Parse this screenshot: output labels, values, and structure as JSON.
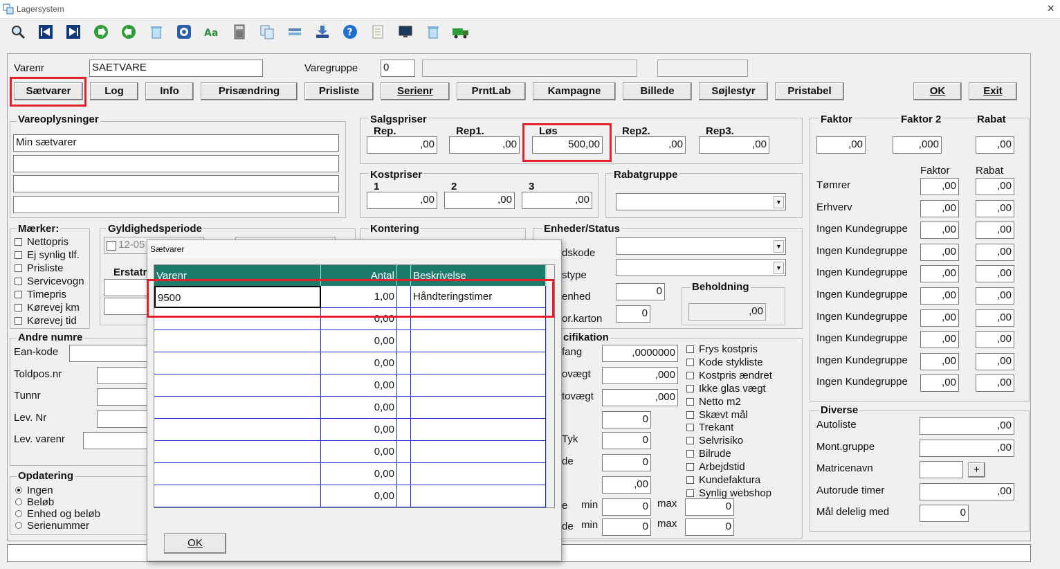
{
  "window": {
    "title": "Lagersystem",
    "close": "×"
  },
  "toolbar": {
    "icons": [
      "search-icon",
      "first-record-icon",
      "last-record-icon",
      "forward-icon",
      "back-icon",
      "delete-icon",
      "target-icon",
      "spell-icon",
      "calculator-icon",
      "copy-icon",
      "transfer-icon",
      "download-icon",
      "help-icon",
      "note-icon",
      "monitor-icon",
      "trash-icon",
      "truck-icon"
    ]
  },
  "header": {
    "varenr_label": "Varenr",
    "varenr_value": "SAETVARE",
    "varegruppe_label": "Varegruppe",
    "varegruppe_value": "0",
    "varegruppe_desc": "",
    "extra_field": ""
  },
  "buttons": {
    "saetvarer": "Sætvarer",
    "log": "Log",
    "info": "Info",
    "prisaendring": "Prisændring",
    "prisliste": "Prisliste",
    "serienr": "Serienr",
    "prntlab": "PrntLab",
    "kampagne": "Kampagne",
    "billede": "Billede",
    "sojlestyr": "Søjlestyr",
    "pristabel": "Pristabel",
    "ok": "OK",
    "exit": "Exit"
  },
  "vareoplysninger": {
    "title": "Vareoplysninger",
    "lines": [
      "Min sætvarer",
      "",
      "",
      ""
    ]
  },
  "salgspriser": {
    "title": "Salgspriser",
    "cols": [
      {
        "label": "Rep.",
        "value": ",00"
      },
      {
        "label": "Rep1.",
        "value": ",00"
      },
      {
        "label": "Løs",
        "value": "500,00"
      },
      {
        "label": "Rep2.",
        "value": ",00"
      },
      {
        "label": "Rep3.",
        "value": ",00"
      }
    ]
  },
  "kostpriser": {
    "title": "Kostpriser",
    "cols": [
      {
        "label": "1",
        "value": ",00"
      },
      {
        "label": "2",
        "value": ",00"
      },
      {
        "label": "3",
        "value": ",00"
      }
    ]
  },
  "rabatgruppe": {
    "title": "Rabatgruppe",
    "value": ""
  },
  "faktor_top": {
    "faktor_label": "Faktor",
    "faktor_value": ",00",
    "faktor2_label": "Faktor 2",
    "faktor2_value": ",000",
    "rabat_label": "Rabat",
    "rabat_value": ",00"
  },
  "kundegrupper": {
    "faktor_header": "Faktor",
    "rabat_header": "Rabat",
    "rows": [
      {
        "name": "Tømrer",
        "faktor": ",00",
        "rabat": ",00"
      },
      {
        "name": "Erhverv",
        "faktor": ",00",
        "rabat": ",00"
      },
      {
        "name": "Ingen Kundegruppe",
        "faktor": ",00",
        "rabat": ",00"
      },
      {
        "name": "Ingen Kundegruppe",
        "faktor": ",00",
        "rabat": ",00"
      },
      {
        "name": "Ingen Kundegruppe",
        "faktor": ",00",
        "rabat": ",00"
      },
      {
        "name": "Ingen Kundegruppe",
        "faktor": ",00",
        "rabat": ",00"
      },
      {
        "name": "Ingen Kundegruppe",
        "faktor": ",00",
        "rabat": ",00"
      },
      {
        "name": "Ingen Kundegruppe",
        "faktor": ",00",
        "rabat": ",00"
      },
      {
        "name": "Ingen Kundegruppe",
        "faktor": ",00",
        "rabat": ",00"
      },
      {
        "name": "Ingen Kundegruppe",
        "faktor": ",00",
        "rabat": ",00"
      }
    ]
  },
  "maerker": {
    "title": "Mærker:",
    "items": [
      "Nettopris",
      "Ej synlig tlf.",
      "Prisliste",
      "Servicevogn",
      "Timepris",
      "Kørevej km",
      "Kørevej tid"
    ]
  },
  "gyldighed": {
    "title": "Gyldighedsperiode",
    "date": "12-05",
    "erstat": "Erstatr"
  },
  "kontering": {
    "title": "Kontering"
  },
  "enheder": {
    "title": "Enheder/Status",
    "labels": [
      "dskode",
      "stype",
      "enhed",
      "or.karton"
    ],
    "enhed_value": "0",
    "karton_value": "0",
    "beholdning_label": "Beholdning",
    "beholdning_value": ",00"
  },
  "specifikation": {
    "title": "cifikation",
    "labels": [
      "fang",
      "ovægt",
      "tovægt",
      "",
      "Tyk",
      "de",
      "",
      "e",
      "de"
    ],
    "values": [
      ",0000000",
      ",000",
      ",000",
      "0",
      "0",
      "0",
      ",00"
    ],
    "min_label": "min",
    "max_label": "max",
    "min_vals": [
      "0",
      "0"
    ],
    "max_vals": [
      "0",
      "0"
    ],
    "checks": [
      "Frys kostpris",
      "Kode stykliste",
      "Kostpris ændret",
      "Ikke glas vægt",
      "Netto m2",
      "Skævt mål",
      "Trekant",
      "Selvrisiko",
      "Bilrude",
      "Arbejdstid",
      "Kundefaktura",
      "Synlig webshop"
    ]
  },
  "andre": {
    "title": "Andre numre",
    "labels": [
      "Ean-kode",
      "Toldpos.nr",
      "Tunnr",
      "Lev. Nr",
      "Lev. varenr"
    ]
  },
  "opdatering": {
    "title": "Opdatering",
    "options": [
      "Ingen",
      "Beløb",
      "Enhed og beløb",
      "Serienummer"
    ]
  },
  "diverse": {
    "title": "Diverse",
    "autoliste_label": "Autoliste",
    "autoliste_value": ",00",
    "montgruppe_label": "Mont.gruppe",
    "montgruppe_value": ",00",
    "matricenavn_label": "Matricenavn",
    "matricenavn_value": "",
    "plus": "+",
    "autorude_label": "Autorude timer",
    "autorude_value": ",00",
    "maal_label": "Mål delelig med",
    "maal_value": "0"
  },
  "dialog": {
    "title": "Sætvarer",
    "headers": [
      "Varenr",
      "Antal",
      "",
      "Beskrivelse"
    ],
    "rows": [
      {
        "varenr": "9500",
        "antal": "1,00",
        "beskrivelse": "Håndteringstimer"
      },
      {
        "varenr": "",
        "antal": "0,00",
        "beskrivelse": ""
      },
      {
        "varenr": "",
        "antal": "0,00",
        "beskrivelse": ""
      },
      {
        "varenr": "",
        "antal": "0,00",
        "beskrivelse": ""
      },
      {
        "varenr": "",
        "antal": "0,00",
        "beskrivelse": ""
      },
      {
        "varenr": "",
        "antal": "0,00",
        "beskrivelse": ""
      },
      {
        "varenr": "",
        "antal": "0,00",
        "beskrivelse": ""
      },
      {
        "varenr": "",
        "antal": "0,00",
        "beskrivelse": ""
      },
      {
        "varenr": "",
        "antal": "0,00",
        "beskrivelse": ""
      },
      {
        "varenr": "",
        "antal": "0,00",
        "beskrivelse": ""
      }
    ],
    "ok": "OK"
  },
  "colors": {
    "highlight": "#e3202b",
    "grid_header": "#1c7b6c",
    "grid_lines": "#1a2ad0"
  }
}
